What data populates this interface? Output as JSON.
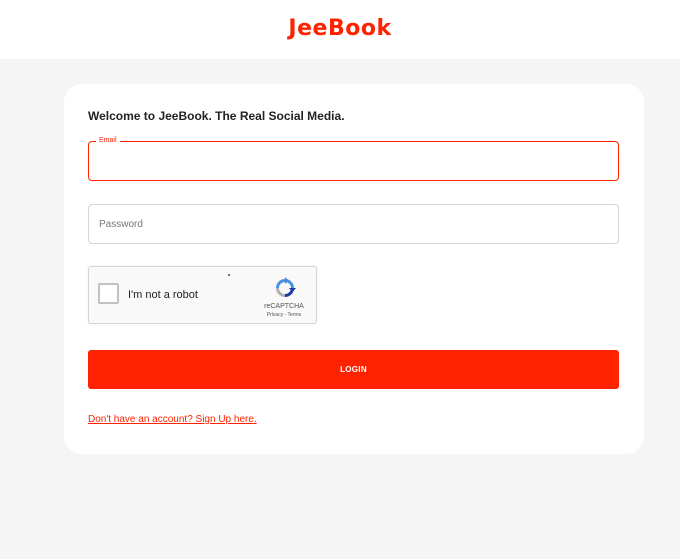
{
  "header": {
    "logo": "JeeBook"
  },
  "form": {
    "welcome": "Welcome to JeeBook. The Real Social Media.",
    "email": {
      "label": "Email",
      "value": ""
    },
    "password": {
      "placeholder": "Password",
      "value": ""
    },
    "captcha": {
      "label": "I'm not a robot",
      "brand": "reCAPTCHA",
      "links": "Privacy - Terms",
      "checked": false
    },
    "login_label": "LOGIN",
    "signup_link": "Don't have an account? Sign Up here."
  },
  "colors": {
    "accent": "#ff2200",
    "background": "#f5f5f5",
    "card": "#ffffff"
  }
}
